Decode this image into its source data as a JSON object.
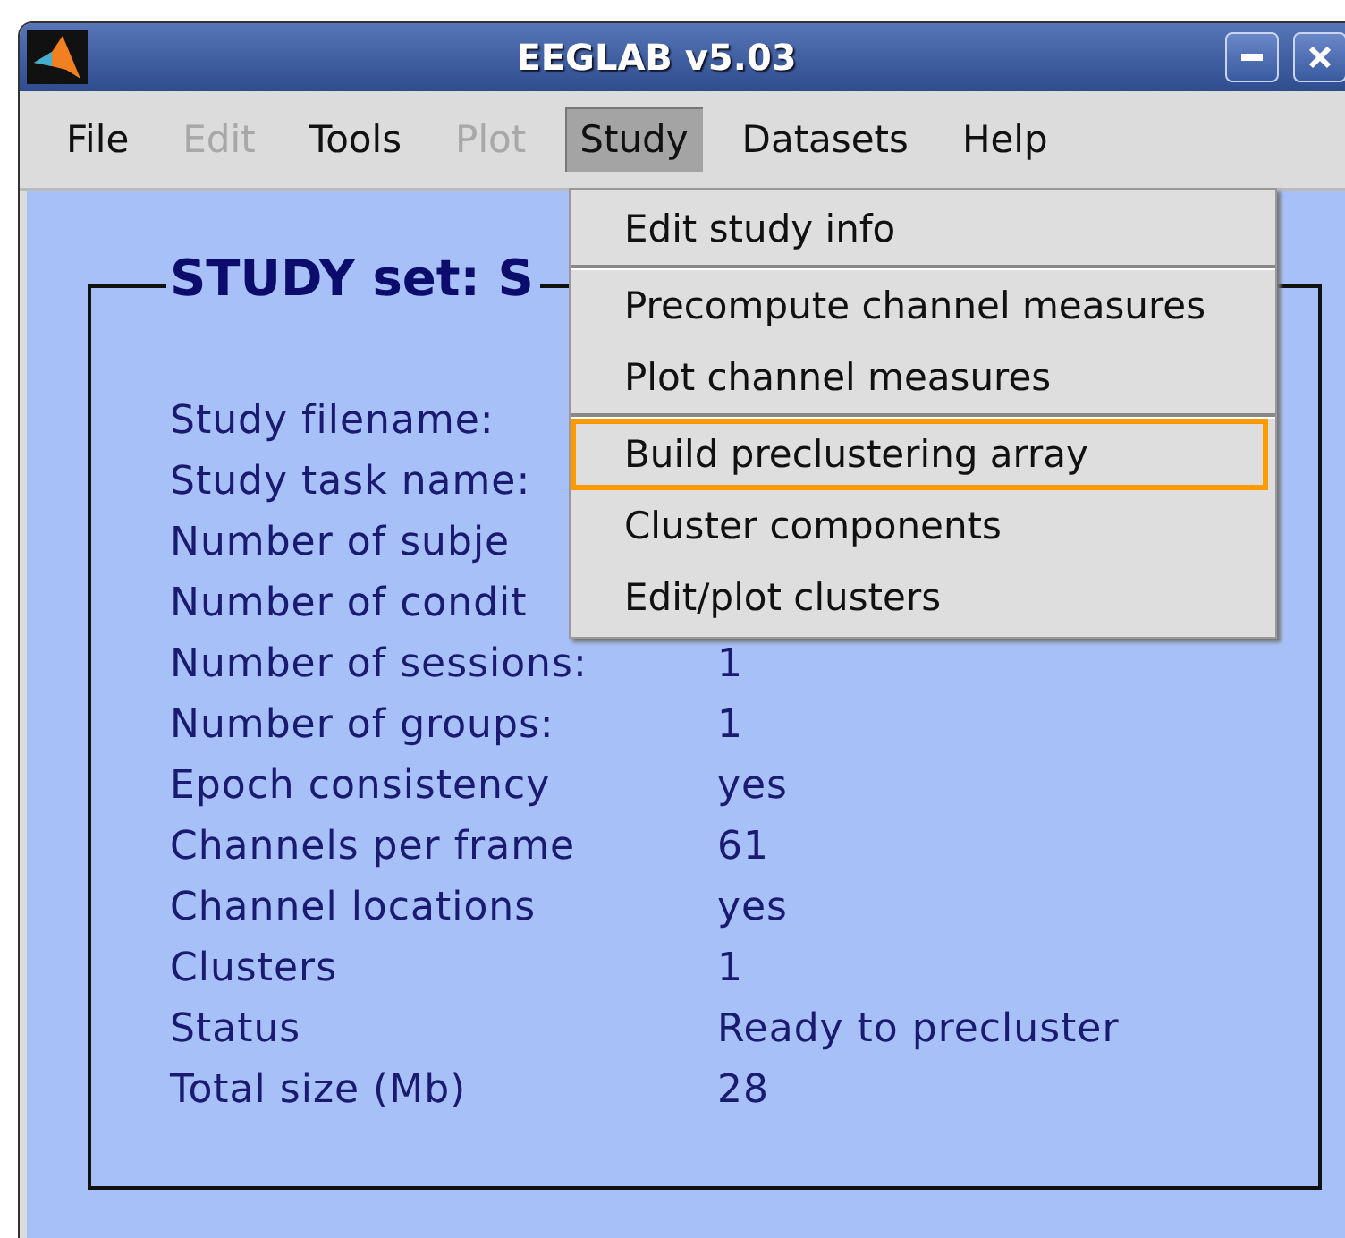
{
  "window": {
    "title": "EEGLAB v5.03"
  },
  "menubar": [
    {
      "label": "File",
      "disabled": false,
      "selected": false
    },
    {
      "label": "Edit",
      "disabled": true,
      "selected": false
    },
    {
      "label": "Tools",
      "disabled": false,
      "selected": false
    },
    {
      "label": "Plot",
      "disabled": true,
      "selected": false
    },
    {
      "label": "Study",
      "disabled": false,
      "selected": true
    },
    {
      "label": "Datasets",
      "disabled": false,
      "selected": false
    },
    {
      "label": "Help",
      "disabled": false,
      "selected": false
    }
  ],
  "menu": [
    {
      "kind": "item",
      "label": "Edit study info",
      "selected": false
    },
    {
      "kind": "separator"
    },
    {
      "kind": "item",
      "label": "Precompute channel measures",
      "selected": false
    },
    {
      "kind": "item",
      "label": "Plot channel measures",
      "selected": false
    },
    {
      "kind": "separator"
    },
    {
      "kind": "item",
      "label": "Build preclustering array",
      "selected": true
    },
    {
      "kind": "item",
      "label": "Cluster components",
      "selected": false
    },
    {
      "kind": "item",
      "label": "Edit/plot clusters",
      "selected": false
    }
  ],
  "panel": {
    "title": "STUDY set: S",
    "rows": [
      {
        "label": "Study filename:"
      },
      {
        "label": "Study task name:"
      },
      {
        "label": "Number of subje"
      },
      {
        "label": "Number of condit"
      },
      {
        "label": "Number of sessions:",
        "value": "1"
      },
      {
        "label": "Number of groups:",
        "value": "1"
      },
      {
        "label": "Epoch consistency",
        "value": "yes"
      },
      {
        "label": "Channels per frame",
        "value": "61"
      },
      {
        "label": "Channel locations",
        "value": "yes"
      },
      {
        "label": "Clusters",
        "value": "1"
      },
      {
        "label": "Status",
        "value": "Ready to precluster"
      },
      {
        "label": "Total size (Mb)",
        "value": "28"
      }
    ]
  }
}
